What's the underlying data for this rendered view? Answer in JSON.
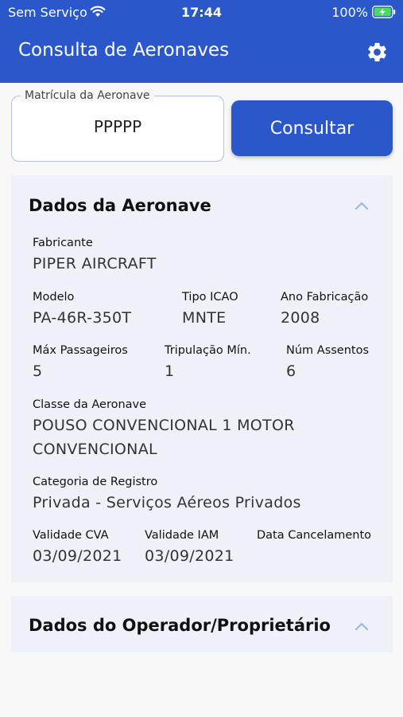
{
  "status_bar": {
    "carrier": "Sem Serviço",
    "time": "17:44",
    "battery": "100%"
  },
  "app_bar": {
    "title": "Consulta de Aeronaves",
    "settings_icon": "gear-icon"
  },
  "search": {
    "label": "Matrícula da Aeronave",
    "value": "PPPPP",
    "button_label": "Consultar"
  },
  "aircraft_section": {
    "title": "Dados da Aeronave",
    "fabricante_label": "Fabricante",
    "fabricante_value": "PIPER AIRCRAFT",
    "modelo_label": "Modelo",
    "modelo_value": "PA-46R-350T",
    "tipo_icao_label": "Tipo ICAO",
    "tipo_icao_value": "MNTE",
    "ano_fabricacao_label": "Ano Fabricação",
    "ano_fabricacao_value": "2008",
    "max_passageiros_label": "Máx Passageiros",
    "max_passageiros_value": "5",
    "tripulacao_min_label": "Tripulação Mín.",
    "tripulacao_min_value": "1",
    "num_assentos_label": "Núm Assentos",
    "num_assentos_value": "6",
    "classe_label": "Classe da Aeronave",
    "classe_value": "POUSO CONVENCIONAL 1 MOTOR CONVENCIONAL",
    "categoria_label": "Categoria de Registro",
    "categoria_value": "Privada - Serviços Aéreos Privados",
    "validade_cva_label": "Validade CVA",
    "validade_cva_value": "03/09/2021",
    "validade_iam_label": "Validade IAM",
    "validade_iam_value": "03/09/2021",
    "data_cancelamento_label": "Data Cancelamento",
    "data_cancelamento_value": ""
  },
  "operator_section": {
    "title": "Dados do Operador/Proprietário"
  },
  "colors": {
    "primary": "#2a57c9",
    "card_bg": "#eef1f8",
    "chevron": "#9fb6e6"
  }
}
